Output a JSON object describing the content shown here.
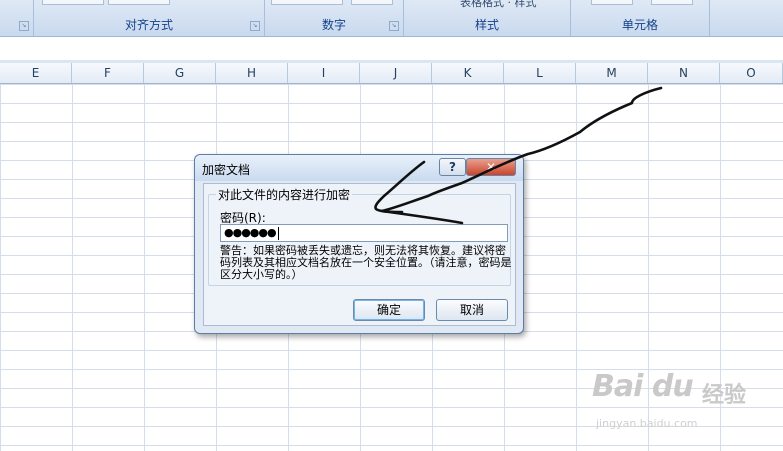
{
  "ribbon": {
    "groups": [
      {
        "label": "对齐方式"
      },
      {
        "label": "数字"
      },
      {
        "label": "样式",
        "partial_text": "表格格式 · 样式"
      },
      {
        "label": "单元格"
      }
    ]
  },
  "columns": [
    "E",
    "F",
    "G",
    "H",
    "I",
    "J",
    "K",
    "L",
    "M",
    "N",
    "O"
  ],
  "dialog": {
    "title": "加密文档",
    "help_symbol": "?",
    "close_symbol": "✕",
    "group_label": "对此文件的内容进行加密",
    "password_label": "密码(R):",
    "password_value": "●●●●●●",
    "warning": "警告：如果密码被丢失或遗忘，则无法将其恢复。建议将密码列表及其相应文档名放在一个安全位置。（请注意，密码是区分大小写的。）",
    "ok_label": "确定",
    "cancel_label": "取消"
  },
  "watermark": {
    "logo": "Bai du",
    "brand": "经验",
    "url": "jingyan.baidu.com"
  },
  "colors": {
    "ribbon_text": "#15428b",
    "dialog_bg": "#dfe8f3",
    "close_button": "#c9452c"
  }
}
